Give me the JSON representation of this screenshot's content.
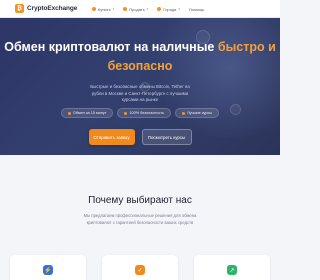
{
  "header": {
    "logo_mark": "₿",
    "logo_text": "CryptoExchange",
    "nav": [
      {
        "label": "Купить",
        "has_caret": true
      },
      {
        "label": "Продать",
        "has_caret": true
      },
      {
        "label": "Города",
        "has_caret": true
      },
      {
        "label": "Помощь",
        "has_caret": false
      }
    ],
    "caret": "▾"
  },
  "hero": {
    "title_line1": "Обмен криптовалют на наличные",
    "title_accent1": "быстро и",
    "title_accent2": "безопасно",
    "subtitle": "Быстрые и безопасные обмены Bitcoin, Tether на рубли в Москве и Санкт-Петербурге с лучшими курсами на рынке",
    "badges": [
      "Обмен за 15 минут",
      "100% безопасность",
      "Лучшие курсы"
    ],
    "primary_button": "Отправить заявку",
    "secondary_button": "Посмотреть курсы"
  },
  "why": {
    "title": "Почему выбирают нас",
    "subtitle": "Мы предлагаем профессиональные решения для обмена криптовалют с гарантией безопасности ваших средств"
  },
  "cards": [
    {
      "icon": "lightning-icon",
      "glyph": "⚡"
    },
    {
      "icon": "shield-icon",
      "glyph": "✓"
    },
    {
      "icon": "chart-icon",
      "glyph": "↗"
    }
  ],
  "colors": {
    "accent": "#f08a1c",
    "hero_background": "#2d3666",
    "card_icons": [
      "#3a6fd8",
      "#f08a1c",
      "#2fb36a"
    ]
  }
}
